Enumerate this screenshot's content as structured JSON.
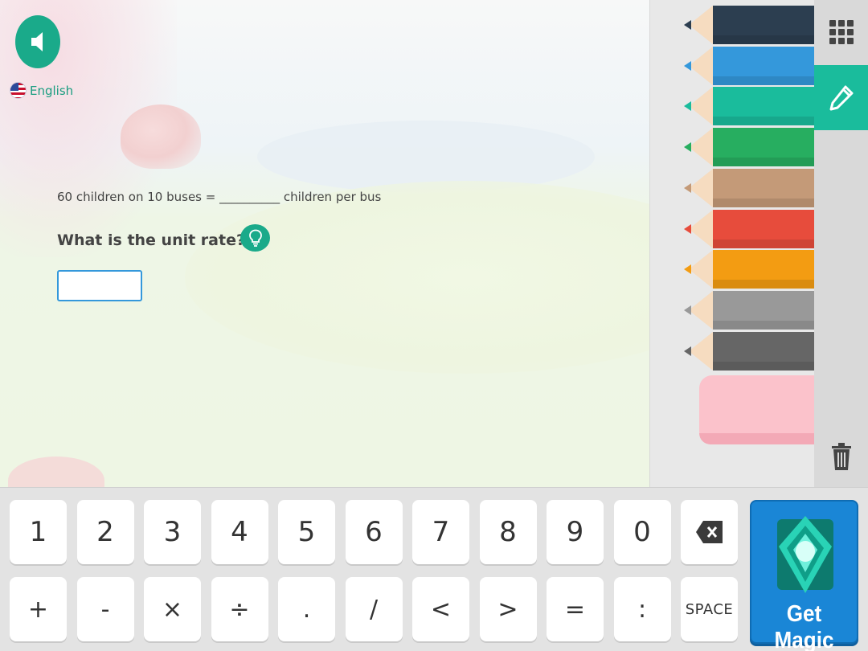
{
  "header": {
    "audio_icon": "speaker-icon",
    "language": {
      "label": "English",
      "icon": "us-flag-icon"
    }
  },
  "question": {
    "problem_text": "60 children on 10 buses = __________ children per bus",
    "prompt": "What is the unit rate?",
    "hint_icon": "lightbulb-icon",
    "answer_value": ""
  },
  "drawing_panel": {
    "pencil_colors": [
      "#2c3e50",
      "#3498db",
      "#1abc9c",
      "#27ae60",
      "#c49a78",
      "#e74c3c",
      "#f39c12",
      "#999999",
      "#666666"
    ],
    "eraser_color": "#fbc2cb"
  },
  "tools": {
    "grid_icon": "keypad-grid-icon",
    "pen_icon": "pencil-icon",
    "trash_icon": "trash-icon",
    "active_color": "#1abc9c"
  },
  "keypad": {
    "row1": [
      "1",
      "2",
      "3",
      "4",
      "5",
      "6",
      "7",
      "8",
      "9",
      "0"
    ],
    "backspace_icon": "backspace-icon",
    "row2": [
      "+",
      "-",
      "×",
      "÷",
      ".",
      "/",
      "<",
      ">",
      "=",
      ":"
    ],
    "space_label": "SPACE",
    "magic_label": "Get Magic"
  }
}
